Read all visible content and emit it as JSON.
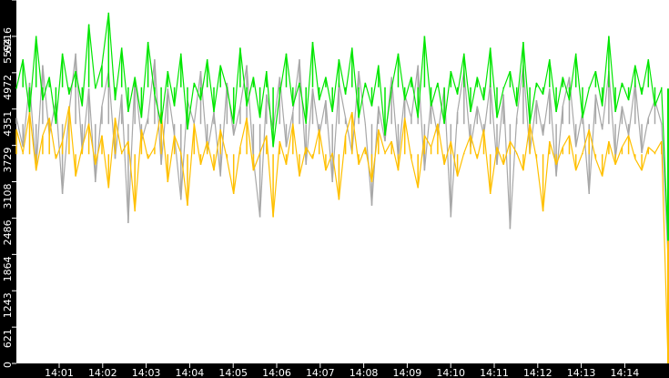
{
  "chart_data": {
    "type": "line",
    "title": "",
    "xlabel": "",
    "ylabel": "",
    "ylim": [
      0,
      6216
    ],
    "y_ticks": [
      "0",
      "621",
      "1243",
      "1864",
      "2486",
      "3108",
      "3729",
      "4351",
      "4972",
      "5594",
      "6216"
    ],
    "x_ticks": [
      "14:01",
      "14:02",
      "14:03",
      "14:04",
      "14:05",
      "14:06",
      "14:07",
      "14:08",
      "14:09",
      "14:10",
      "14:11",
      "14:12",
      "14:13",
      "14:14"
    ],
    "x_range_minutes": [
      14.0,
      15.0
    ],
    "grid": false,
    "series": [
      {
        "name": "gray",
        "color": "#a8a8a8",
        "values": [
          4200,
          3700,
          4800,
          3300,
          5100,
          3900,
          4500,
          2900,
          4300,
          5300,
          3600,
          4700,
          3100,
          4400,
          5000,
          3500,
          4600,
          2400,
          4900,
          3800,
          4200,
          5200,
          3400,
          4700,
          3900,
          2800,
          4500,
          4100,
          5000,
          3600,
          4300,
          3200,
          4800,
          3900,
          4400,
          5100,
          3500,
          2500,
          4600,
          4000,
          4900,
          3700,
          4300,
          5200,
          3400,
          4700,
          3900,
          4500,
          3100,
          4800,
          4200,
          3600,
          5000,
          4100,
          2700,
          4400,
          3800,
          4900,
          3500,
          4600,
          4200,
          5100,
          3300,
          4500,
          3900,
          4700,
          2500,
          4300,
          5000,
          3700,
          4400,
          3900,
          4800,
          3400,
          4600,
          2300,
          4200,
          5100,
          3600,
          4500,
          3900,
          4700,
          3200,
          4400,
          4900,
          3700,
          4300,
          2900,
          4600,
          4000,
          5000,
          3500,
          4400,
          3900,
          4800,
          3600,
          4200,
          4500,
          4100,
          1800
        ],
        "colorNote": ""
      },
      {
        "name": "yellow",
        "color": "#ffc000",
        "values": [
          4000,
          3600,
          4300,
          3300,
          3900,
          4200,
          3500,
          3800,
          4400,
          3200,
          3700,
          4100,
          3400,
          3900,
          3000,
          4200,
          3600,
          3800,
          2600,
          4000,
          3500,
          3700,
          4300,
          3100,
          3900,
          3600,
          2700,
          4100,
          3400,
          3800,
          3300,
          4000,
          3500,
          2900,
          3700,
          4200,
          3300,
          3600,
          3900,
          2500,
          3800,
          3400,
          4100,
          3200,
          3700,
          3500,
          4000,
          3300,
          3600,
          2800,
          3900,
          4300,
          3400,
          3700,
          3100,
          4000,
          3600,
          3800,
          3300,
          4200,
          3500,
          3000,
          3900,
          3700,
          4100,
          3400,
          3800,
          3200,
          3600,
          3900,
          3500,
          4000,
          2900,
          3700,
          3400,
          3800,
          3600,
          3300,
          4100,
          3500,
          2600,
          3800,
          3400,
          3700,
          3900,
          3300,
          3600,
          4000,
          3500,
          3200,
          3800,
          3400,
          3700,
          3900,
          3500,
          3300,
          3700,
          3600,
          3800,
          0
        ]
      },
      {
        "name": "green",
        "color": "#00e600",
        "values": [
          4700,
          5200,
          4300,
          5600,
          4500,
          4900,
          4100,
          5300,
          4600,
          5000,
          4400,
          5800,
          4700,
          5100,
          6000,
          4500,
          5400,
          4300,
          4900,
          4200,
          5500,
          4600,
          4100,
          5000,
          4400,
          5300,
          4000,
          4800,
          4500,
          5200,
          4300,
          5100,
          4700,
          4100,
          5400,
          4400,
          4900,
          4200,
          5000,
          3700,
          4600,
          5300,
          4400,
          4800,
          4100,
          5500,
          4500,
          4900,
          4300,
          5200,
          4600,
          5400,
          4200,
          4800,
          4400,
          5100,
          3900,
          4700,
          5300,
          4500,
          4900,
          4200,
          5600,
          4400,
          4800,
          4100,
          5000,
          4600,
          5300,
          4300,
          4900,
          4500,
          5400,
          4200,
          4700,
          5000,
          4400,
          5500,
          4100,
          4800,
          4600,
          5200,
          4300,
          4900,
          4500,
          5300,
          4200,
          4700,
          5000,
          4400,
          5600,
          4300,
          4800,
          4500,
          5100,
          4600,
          5200,
          4400,
          4700,
          2100
        ]
      }
    ]
  }
}
